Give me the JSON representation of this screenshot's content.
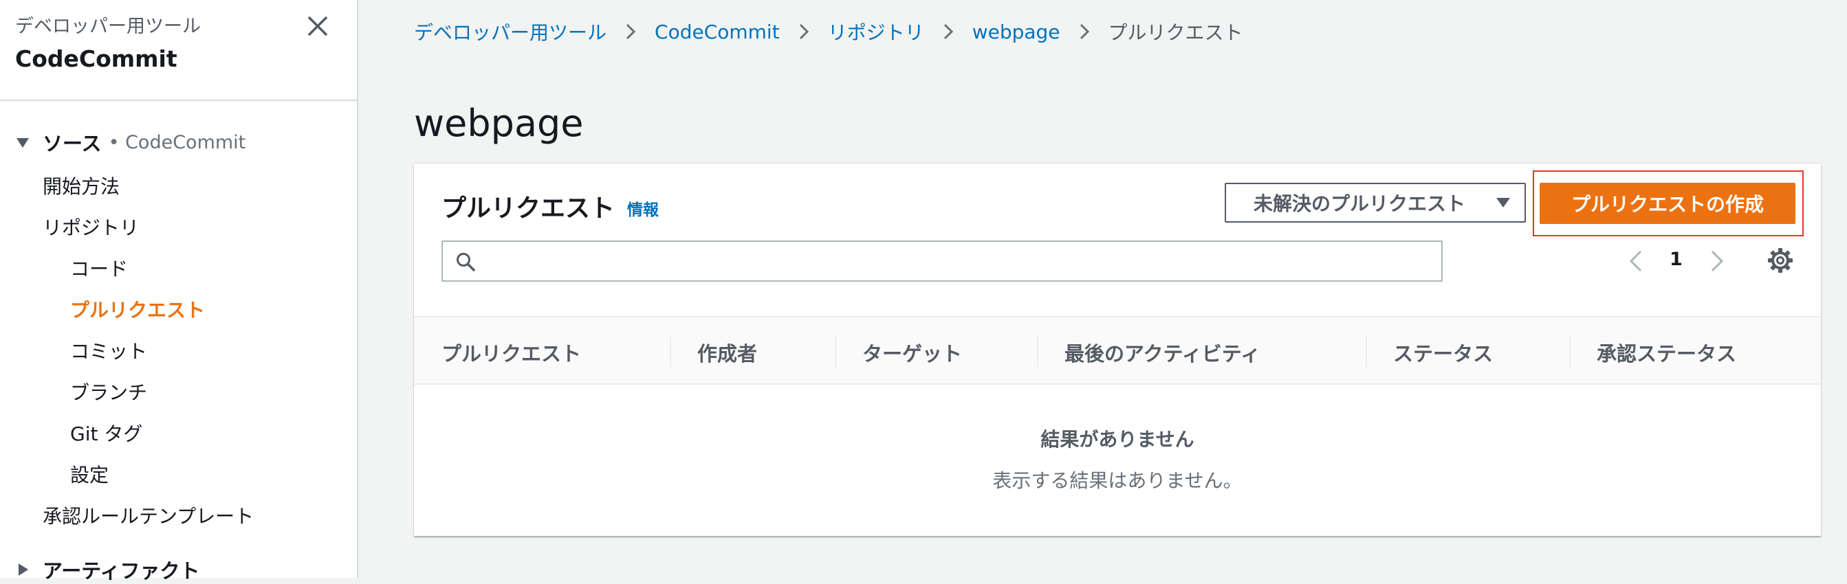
{
  "sidebar": {
    "service_label": "デベロッパー用ツール",
    "title": "CodeCommit",
    "sections": [
      {
        "label": "ソース",
        "sub": "• CodeCommit",
        "expanded": true
      },
      {
        "label": "アーティファクト",
        "expanded": false
      }
    ],
    "items": [
      {
        "label": "開始方法"
      },
      {
        "label": "リポジトリ"
      },
      {
        "label": "コード"
      },
      {
        "label": "プルリクエスト",
        "active": true
      },
      {
        "label": "コミット"
      },
      {
        "label": "ブランチ"
      },
      {
        "label": "Git タグ"
      },
      {
        "label": "設定"
      },
      {
        "label": "承認ルールテンプレート"
      }
    ]
  },
  "breadcrumb": [
    {
      "label": "デベロッパー用ツール"
    },
    {
      "label": "CodeCommit"
    },
    {
      "label": "リポジトリ"
    },
    {
      "label": "webpage"
    },
    {
      "label": "プルリクエスト"
    }
  ],
  "page_title": "webpage",
  "panel": {
    "title": "プルリクエスト",
    "info_link": "情報",
    "filter_selected": "未解決のプルリクエスト",
    "create_button": "プルリクエストの作成",
    "search_placeholder": "",
    "page_number": "1",
    "columns": [
      "プルリクエスト",
      "作成者",
      "ターゲット",
      "最後のアクティビティ",
      "ステータス",
      "承認ステータス"
    ],
    "empty_title": "結果がありません",
    "empty_message": "表示する結果はありません。"
  },
  "colors": {
    "accent": "#ec7211",
    "link": "#0073bb",
    "highlight": "#e8352b"
  }
}
